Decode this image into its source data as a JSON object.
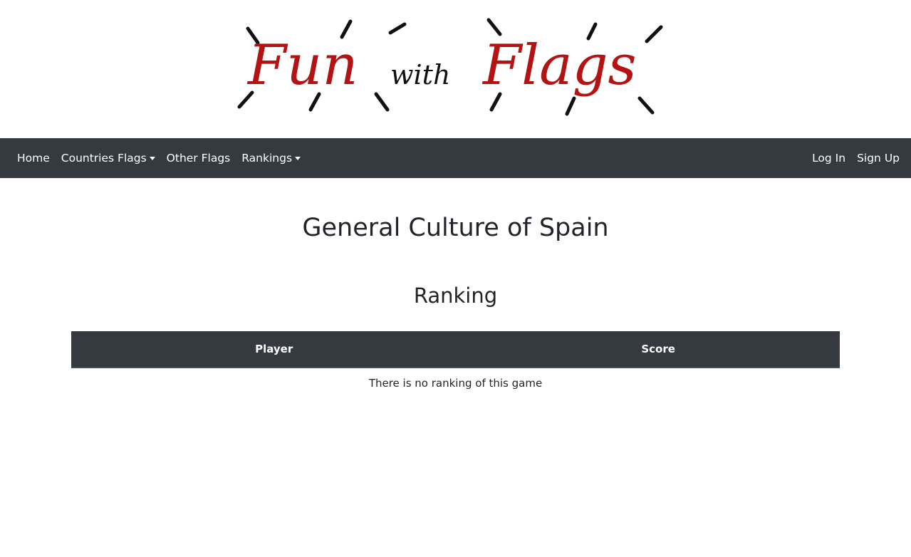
{
  "logo": {
    "text_fun": "Fun",
    "text_with": "with",
    "text_flags": "Flags",
    "accent_color": "#b31313",
    "ray_color": "#111111"
  },
  "navbar": {
    "background": "#343a40",
    "left_items": [
      {
        "label": "Home",
        "has_dropdown": false
      },
      {
        "label": "Countries Flags",
        "has_dropdown": true
      },
      {
        "label": "Other Flags",
        "has_dropdown": false
      },
      {
        "label": "Rankings",
        "has_dropdown": true
      }
    ],
    "right_items": [
      {
        "label": "Log In"
      },
      {
        "label": "Sign Up"
      }
    ]
  },
  "main": {
    "title": "General Culture of Spain",
    "section_title": "Ranking",
    "table": {
      "columns": [
        "Player",
        "Score"
      ],
      "empty_message": "There is no ranking of this game"
    }
  }
}
